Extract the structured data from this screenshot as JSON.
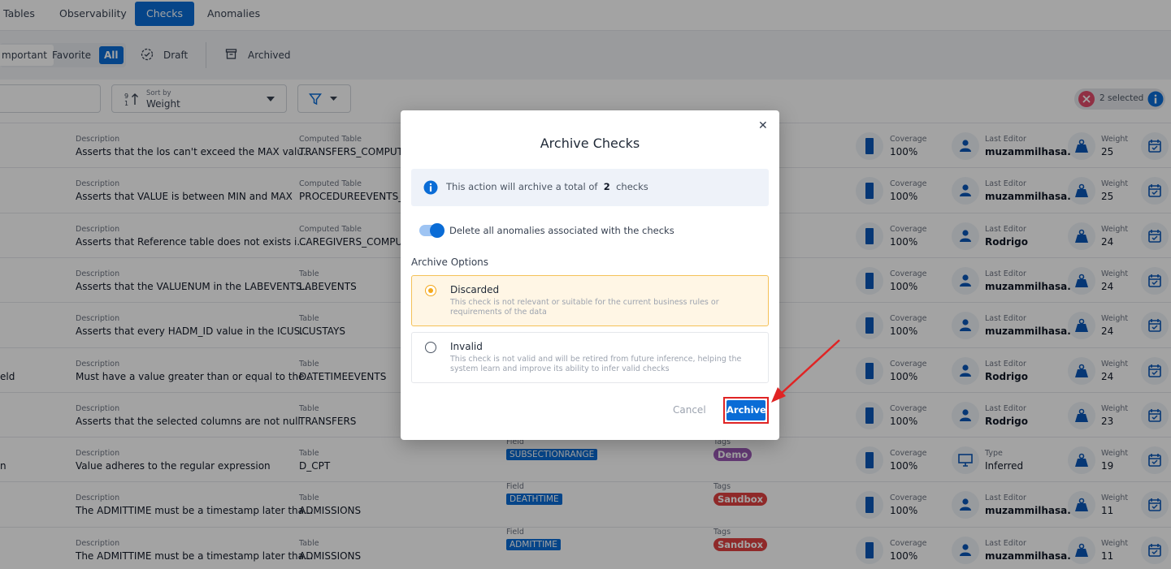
{
  "nav": {
    "tabs": [
      {
        "label": "Tables"
      },
      {
        "label": "Observability"
      },
      {
        "label": "Checks"
      },
      {
        "label": "Anomalies"
      }
    ]
  },
  "filters": {
    "important": "mportant",
    "favorite": "Favorite",
    "all": "All",
    "draft": "Draft",
    "archived": "Archived"
  },
  "sort": {
    "caption": "Sort by",
    "value": "Weight"
  },
  "selection": {
    "label": "2 selected"
  },
  "rows": [
    {
      "lead": "",
      "description_label": "Description",
      "description": "Asserts that the los can't exceed the MAX valu...",
      "table_label": "Computed Table",
      "table": "TRANSFERS_COMPUTE",
      "field_label": "",
      "field": "",
      "tags_label": "",
      "tag": "",
      "coverage_label": "Coverage",
      "coverage": "100%",
      "editor_label": "Last Editor",
      "editor": "muzammilhasa...",
      "weight_label": "Weight",
      "weight": "25"
    },
    {
      "lead": "",
      "description_label": "Description",
      "description": "Asserts that VALUE is between MIN and MAX",
      "table_label": "Computed Table",
      "table": "PROCEDUREEVENTS_M",
      "field_label": "",
      "field": "",
      "tags_label": "",
      "tag": "",
      "coverage_label": "Coverage",
      "coverage": "100%",
      "editor_label": "Last Editor",
      "editor": "muzammilhasa...",
      "weight_label": "Weight",
      "weight": "25"
    },
    {
      "lead": "",
      "description_label": "Description",
      "description": "Asserts that Reference table does not exists i...",
      "table_label": "Computed Table",
      "table": "CAREGIVERS_COMPUT",
      "field_label": "",
      "field": "",
      "tags_label": "",
      "tag": "",
      "coverage_label": "Coverage",
      "coverage": "100%",
      "editor_label": "Last Editor",
      "editor": "Rodrigo",
      "weight_label": "Weight",
      "weight": "24"
    },
    {
      "lead": "",
      "description_label": "Description",
      "description": "Asserts that the VALUENUM in the LABEVENTS...",
      "table_label": "Table",
      "table": "LABEVENTS",
      "field_label": "",
      "field": "",
      "tags_label": "",
      "tag": "",
      "coverage_label": "Coverage",
      "coverage": "100%",
      "editor_label": "Last Editor",
      "editor": "muzammilhasa...",
      "weight_label": "Weight",
      "weight": "24"
    },
    {
      "lead": "",
      "description_label": "Description",
      "description": "Asserts that every HADM_ID value in the ICUS...",
      "table_label": "Table",
      "table": "ICUSTAYS",
      "field_label": "",
      "field": "",
      "tags_label": "",
      "tag": "",
      "coverage_label": "Coverage",
      "coverage": "100%",
      "editor_label": "Last Editor",
      "editor": "muzammilhasa...",
      "weight_label": "Weight",
      "weight": "24"
    },
    {
      "lead": "eld",
      "description_label": "Description",
      "description": "Must have a value greater than or equal to the ...",
      "table_label": "Table",
      "table": "DATETIMEEVENTS",
      "field_label": "",
      "field": "",
      "tags_label": "",
      "tag": "",
      "coverage_label": "Coverage",
      "coverage": "100%",
      "editor_label": "Last Editor",
      "editor": "Rodrigo",
      "weight_label": "Weight",
      "weight": "24"
    },
    {
      "lead": "",
      "description_label": "Description",
      "description": "Asserts that the selected columns are not null",
      "table_label": "Table",
      "table": "TRANSFERS",
      "field_label": "",
      "field": "",
      "tags_label": "",
      "tag": "",
      "coverage_label": "Coverage",
      "coverage": "100%",
      "editor_label": "Last Editor",
      "editor": "Rodrigo",
      "weight_label": "Weight",
      "weight": "23"
    },
    {
      "lead": "n",
      "description_label": "Description",
      "description": "Value adheres to the regular expression",
      "table_label": "Table",
      "table": "D_CPT",
      "field_label": "Field",
      "field": "SUBSECTIONRANGE",
      "tags_label": "Tags",
      "tag": "Demo",
      "coverage_label": "Coverage",
      "coverage": "100%",
      "editor_label": "Type",
      "editor": "Inferred",
      "weight_label": "Weight",
      "weight": "19"
    },
    {
      "lead": "",
      "description_label": "Description",
      "description": "The ADMITTIME must be a timestamp later tha...",
      "table_label": "Table",
      "table": "ADMISSIONS",
      "field_label": "Field",
      "field": "DEATHTIME",
      "tags_label": "Tags",
      "tag": "Sandbox",
      "coverage_label": "Coverage",
      "coverage": "100%",
      "editor_label": "Last Editor",
      "editor": "muzammilhasa...",
      "weight_label": "Weight",
      "weight": "11"
    },
    {
      "lead": "",
      "description_label": "Description",
      "description": "The ADMITTIME must be a timestamp later tha...",
      "table_label": "Table",
      "table": "ADMISSIONS",
      "field_label": "Field",
      "field": "ADMITTIME",
      "tags_label": "Tags",
      "tag": "Sandbox",
      "coverage_label": "Coverage",
      "coverage": "100%",
      "editor_label": "Last Editor",
      "editor": "muzammilhasa...",
      "weight_label": "Weight",
      "weight": "11"
    }
  ],
  "tag_colors": {
    "Demo": "#9b59b6",
    "Sandbox": "#e04040"
  },
  "colors": {
    "accent": "#0a6cd6",
    "danger": "#e02424",
    "warning": "#f4a81c"
  },
  "modal": {
    "title": "Archive Checks",
    "info_prefix": "This action will archive a total of",
    "info_count": "2",
    "info_suffix": "checks",
    "toggle_label": "Delete all anomalies associated with the checks",
    "toggle_on": true,
    "options_label": "Archive Options",
    "options": [
      {
        "name": "Discarded",
        "desc": "This check is not relevant or suitable for the current business rules or requirements of the data",
        "selected": true
      },
      {
        "name": "Invalid",
        "desc": "This check is not valid and will be retired from future inference, helping the system learn and improve its ability to infer valid checks",
        "selected": false
      }
    ],
    "cancel_label": "Cancel",
    "archive_label": "Archive"
  }
}
